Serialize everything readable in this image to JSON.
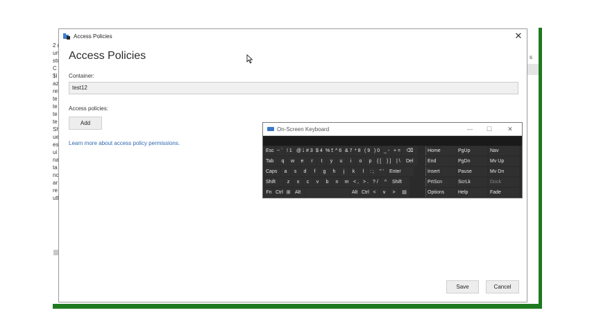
{
  "background_app": {
    "left_list_fragments": [
      "2 (",
      "un",
      "str",
      "C",
      "$l",
      "az",
      "ref",
      "te",
      "te",
      "te",
      "te",
      "Sh",
      "ue",
      "es",
      "ui",
      "na",
      "ta",
      "nc",
      "ar",
      "re",
      "uth"
    ],
    "right_fragment": "s"
  },
  "dialog": {
    "window_title": "Access Policies",
    "close_glyph": "✕",
    "heading": "Access Policies",
    "container_label": "Container:",
    "container_value": "test12",
    "access_policies_label": "Access policies:",
    "add_label": "Add",
    "learn_more_link": "Learn more about access policy permissions.",
    "save_label": "Save",
    "cancel_label": "Cancel",
    "icon": "folder-lock-icon"
  },
  "osk": {
    "title": "On-Screen Keyboard",
    "min_glyph": "—",
    "max_glyph": "☐",
    "close_glyph": "✕",
    "rows": [
      [
        "Esc",
        "~ `",
        "! 1",
        "@ 2",
        "# 3",
        "$ 4",
        "% 5",
        "^ 6",
        "& 7",
        "* 8",
        "( 9",
        ") 0",
        "_ -",
        "+ =",
        "⌫"
      ],
      [
        "Tab",
        "q",
        "w",
        "e",
        "r",
        "t",
        "y",
        "u",
        "i",
        "o",
        "p",
        "{ [",
        "} ]",
        "| \\",
        "Del"
      ],
      [
        "Caps",
        "a",
        "s",
        "d",
        "f",
        "g",
        "h",
        "j",
        "k",
        "l",
        ": ;",
        "\" '",
        "Enter"
      ],
      [
        "Shift",
        "z",
        "x",
        "c",
        "v",
        "b",
        "n",
        "m",
        "< ,",
        "> .",
        "? /",
        "^",
        "Shift"
      ],
      [
        "Fn",
        "Ctrl",
        "⊞",
        "Alt",
        "",
        "Alt",
        "Ctrl",
        "<",
        "∨",
        ">",
        "▤"
      ]
    ],
    "nav_cols": [
      [
        "Home",
        "End",
        "Insert",
        "PrtScn",
        "Options"
      ],
      [
        "PgUp",
        "PgDn",
        "Pause",
        "ScrLk",
        "Help"
      ],
      [
        "Nav",
        "Mv Up",
        "Mv Dn",
        "Dock",
        "Fade"
      ]
    ]
  }
}
